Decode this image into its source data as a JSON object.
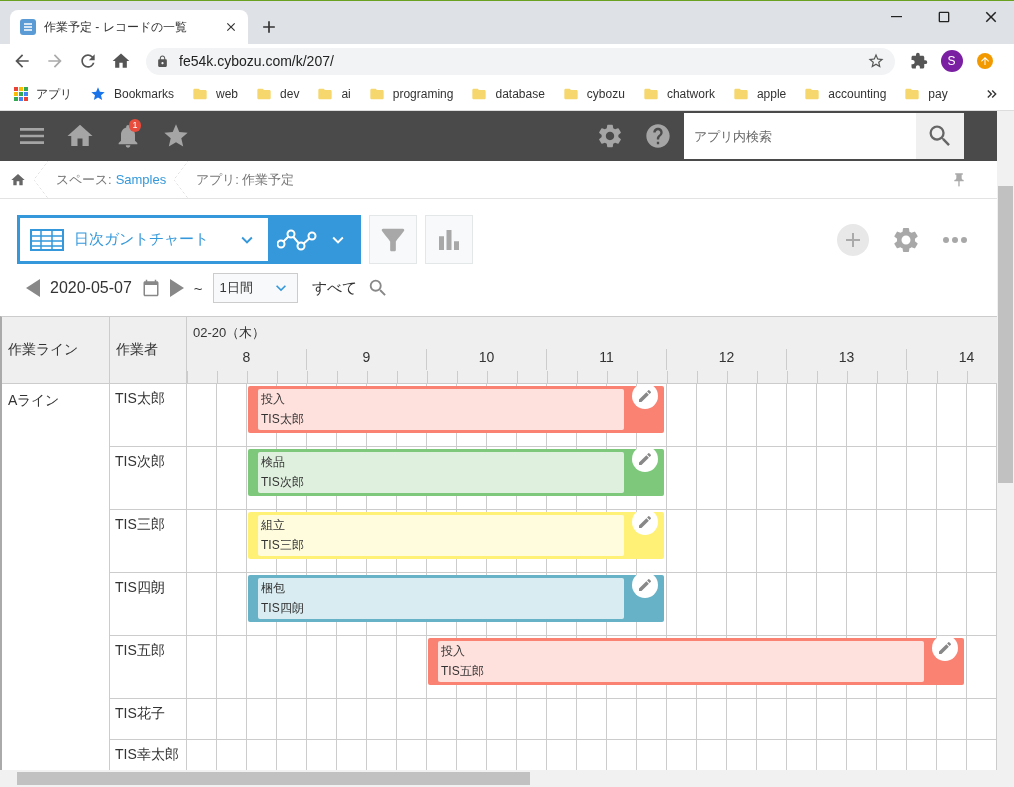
{
  "browser": {
    "tabs": [
      {
        "title": "作業予定 - レコードの一覧",
        "selected": true
      }
    ],
    "url": "fe54k.cybozu.com/k/207/",
    "profile": "S",
    "bookmarks": [
      {
        "kind": "apps",
        "label": "アプリ"
      },
      {
        "kind": "star",
        "label": "Bookmarks"
      },
      {
        "kind": "folder",
        "label": "web"
      },
      {
        "kind": "folder",
        "label": "dev"
      },
      {
        "kind": "folder",
        "label": "ai"
      },
      {
        "kind": "folder",
        "label": "programing"
      },
      {
        "kind": "folder",
        "label": "database"
      },
      {
        "kind": "folder",
        "label": "cybozu"
      },
      {
        "kind": "folder",
        "label": "chatwork"
      },
      {
        "kind": "folder",
        "label": "apple"
      },
      {
        "kind": "folder",
        "label": "accounting"
      },
      {
        "kind": "folder",
        "label": "pay"
      }
    ]
  },
  "header": {
    "notification_count": "1",
    "search": {
      "placeholder": "アプリ内検索"
    }
  },
  "breadcrumb": [
    {
      "label": "スペース:",
      "link": "Samples"
    },
    {
      "label": "アプリ: 作業予定"
    }
  ],
  "toolbar": {
    "view": "日次ガントチャート"
  },
  "date_nav": {
    "date": "2020-05-07",
    "separator": "~",
    "period": "1日間",
    "range": "すべて"
  },
  "gantt": {
    "columns": [
      "作業ライン",
      "作業者"
    ],
    "day": "02-20（木）",
    "hours": [
      "8",
      "9",
      "10",
      "11",
      "12",
      "13",
      "14"
    ],
    "groups": [
      {
        "line": "Aライン",
        "rows": [
          {
            "worker": "TIS太郎",
            "task": {
              "title": "投入",
              "assignee": "TIS太郎",
              "color": "#fa8273"
            }
          },
          {
            "worker": "TIS次郎",
            "task": {
              "title": "検品",
              "assignee": "TIS次郎",
              "color": "#7dc87a"
            }
          },
          {
            "worker": "TIS三郎",
            "task": {
              "title": "組立",
              "assignee": "TIS三郎",
              "color": "#fff176"
            }
          },
          {
            "worker": "TIS四朗",
            "task": {
              "title": "梱包",
              "assignee": "TIS四朗",
              "color": "#67b2c7"
            }
          },
          {
            "worker": "TIS五郎",
            "task": {
              "title": "投入",
              "assignee": "TIS五郎",
              "color": "#fa8273"
            }
          },
          {
            "worker": "TIS花子"
          },
          {
            "worker": "TIS幸太郎"
          }
        ]
      }
    ]
  }
}
